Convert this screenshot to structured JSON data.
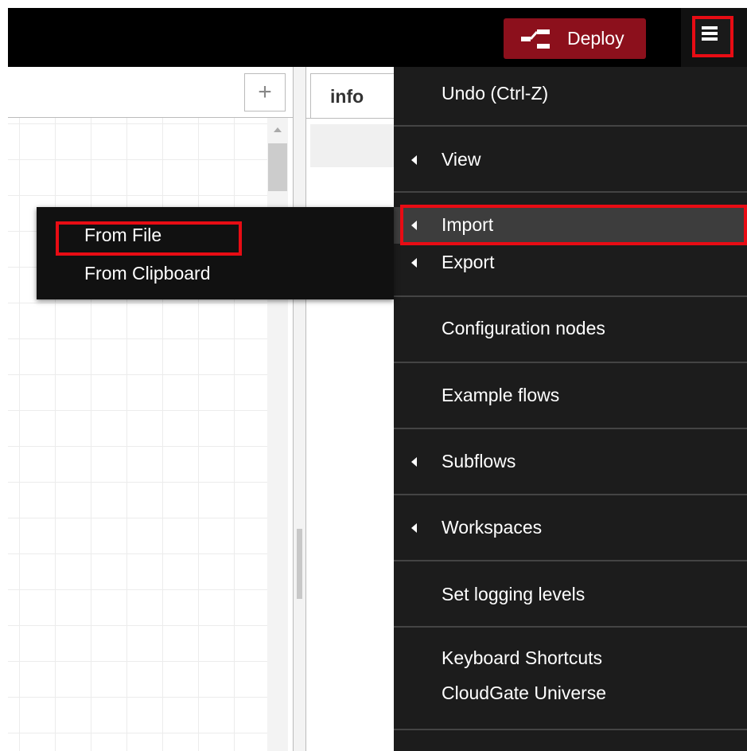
{
  "header": {
    "deploy_label": "Deploy",
    "accent_color": "#8c101c",
    "menu_icon": "hamburger-menu-icon",
    "deploy_icon": "deploy-flow-icon"
  },
  "workspace": {
    "add_tab_symbol": "+"
  },
  "sidebar": {
    "info_tab_label": "info"
  },
  "main_menu": {
    "undo": "Undo (Ctrl-Z)",
    "view": "View",
    "import": "Import",
    "export": "Export",
    "configuration_nodes": "Configuration nodes",
    "example_flows": "Example flows",
    "subflows": "Subflows",
    "workspaces": "Workspaces",
    "set_logging_levels": "Set logging levels",
    "keyboard_shortcuts": "Keyboard Shortcuts",
    "cloudgate_universe": "CloudGate Universe"
  },
  "import_submenu": {
    "from_file": "From File",
    "from_clipboard": "From Clipboard"
  },
  "highlight_color": "#e80c14"
}
